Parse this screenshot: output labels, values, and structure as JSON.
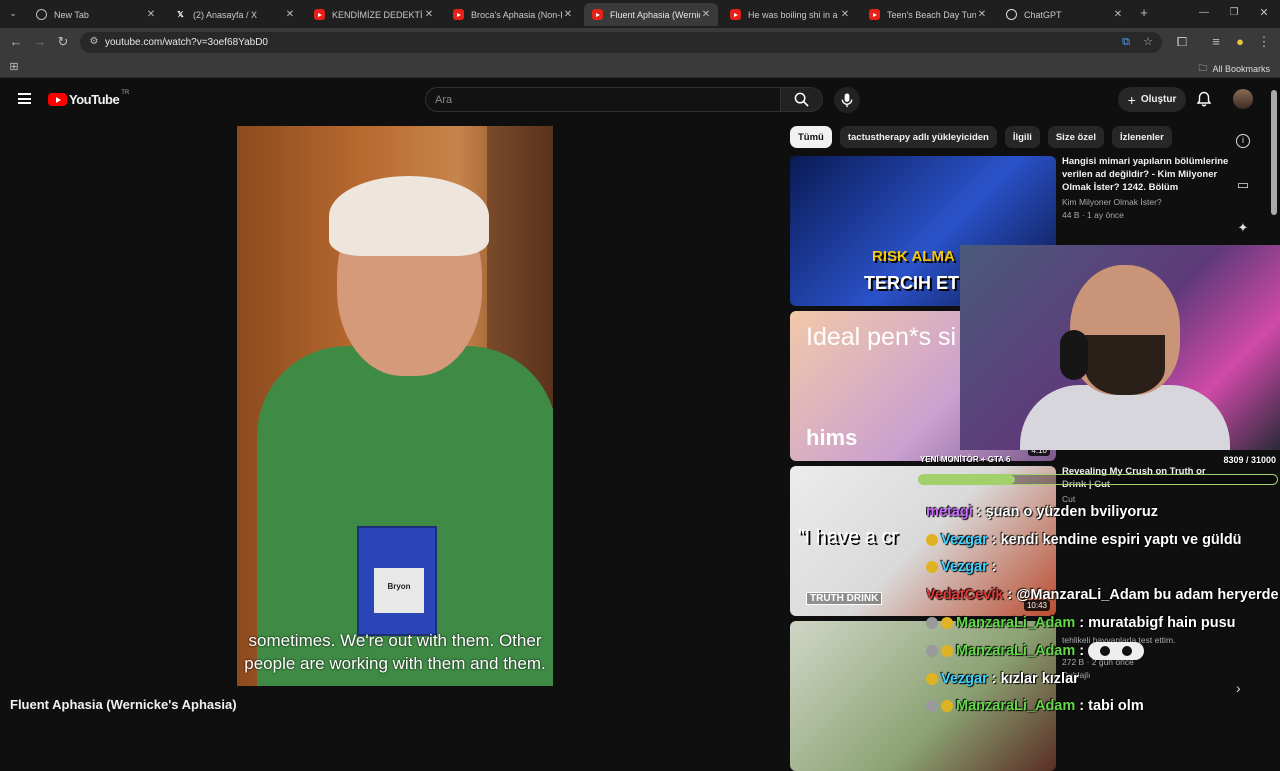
{
  "browser": {
    "tabs": [
      {
        "title": "New Tab",
        "icon": "globe-icon"
      },
      {
        "title": "(2) Anasayfa / X",
        "icon": "x-logo-icon"
      },
      {
        "title": "KENDİMİZE DEDEKTİF TU",
        "icon": "youtube-icon"
      },
      {
        "title": "Broca's Aphasia (Non-Flu",
        "icon": "youtube-icon"
      },
      {
        "title": "Fluent Aphasia (Wernicke",
        "icon": "youtube-icon"
      },
      {
        "title": "He was boiling shi in a ke",
        "icon": "youtube-icon"
      },
      {
        "title": "Teen's Beach Day Turns In",
        "icon": "youtube-icon"
      },
      {
        "title": "ChatGPT",
        "icon": "chatgpt-icon"
      }
    ],
    "active_tab": 4,
    "url": "youtube.com/watch?v=3oef68YabD0",
    "all_bookmarks": "All Bookmarks"
  },
  "youtube": {
    "logo": "YouTube",
    "country": "TR",
    "search_placeholder": "Ara",
    "create_label": "Oluştur",
    "colors": {
      "accent": "#ff0000",
      "chip_active": "#f1f1f1"
    }
  },
  "video": {
    "title": "Fluent Aphasia (Wernicke's Aphasia)",
    "subtitle_line1": "sometimes. We're out with them. Other",
    "subtitle_line2": "people are working with them and them.",
    "badge_name": "Bryon"
  },
  "chips": [
    "Tümü",
    "tactustherapy adlı yükleyiciden",
    "İlgili",
    "Size özel",
    "İzlenenler"
  ],
  "recommendations": [
    {
      "title": "Hangisi mimari yapıların bölümlerine verilen ad değildir? - Kim Milyoner Olmak İster? 1242. Bölüm",
      "channel": "Kim Milyoner Olmak İster?",
      "meta": "44 B · 1 ay önce",
      "thumb_text_1": "RISK ALMA",
      "thumb_text_2": "TERCIH ET"
    },
    {
      "title": "",
      "channel": "",
      "meta": "",
      "thumb_text_1": "Ideal pen*s si",
      "thumb_text_2": "hims",
      "duration": "4:10"
    },
    {
      "title": "Revealing My Crush on Truth or Drink | Cut",
      "channel": "Cut",
      "meta": "",
      "thumb_text_1": "“I have a cr",
      "thumb_text_2": "TRUTH DRINK",
      "duration": "10:43"
    },
    {
      "title": "",
      "channel": "Dublajlı",
      "meta": "272 B · 2 gün önce",
      "snippet": "tehlikeli hayvanlarla test ettim."
    }
  ],
  "stream_overlay": {
    "monitor_label": "YENİ MONİTÖR + GTA 6",
    "goal_count": "8309 / 31000",
    "goal_fraction": 0.268,
    "chat": [
      {
        "user": "metagi",
        "text": ": şuan o yüzden bviliyoruz",
        "color": "#c86bff",
        "badges": []
      },
      {
        "user": "Vezgar",
        "text": ": kendi kendine espiri yaptı ve güldü",
        "color": "#3fd2ff",
        "badges": [
          "#e0b323"
        ]
      },
      {
        "user": "Vezgar",
        "text": ":",
        "color": "#3fd2ff",
        "badges": [
          "#e0b323"
        ]
      },
      {
        "user": "VedatCevik",
        "text": ": @ManzaraLi_Adam bu adam heryerde",
        "color": "#e03a3a",
        "badges": []
      },
      {
        "user": "ManzaraLi_Adam",
        "text": ": muratabigf hain pusu",
        "color": "#62d84a",
        "badges": [
          "#9a9a9a",
          "#e0b323"
        ]
      },
      {
        "user": "ManzaraLi_Adam",
        "text": ":",
        "color": "#62d84a",
        "badges": [
          "#9a9a9a",
          "#e0b323"
        ],
        "emote": true
      },
      {
        "user": "Vezgar",
        "text": ": kızlar kızlar",
        "color": "#3fd2ff",
        "badges": [
          "#e0b323"
        ]
      },
      {
        "user": "ManzaraLi_Adam",
        "text": ": tabi olm",
        "color": "#62d84a",
        "badges": [
          "#9a9a9a",
          "#e0b323"
        ]
      }
    ]
  }
}
